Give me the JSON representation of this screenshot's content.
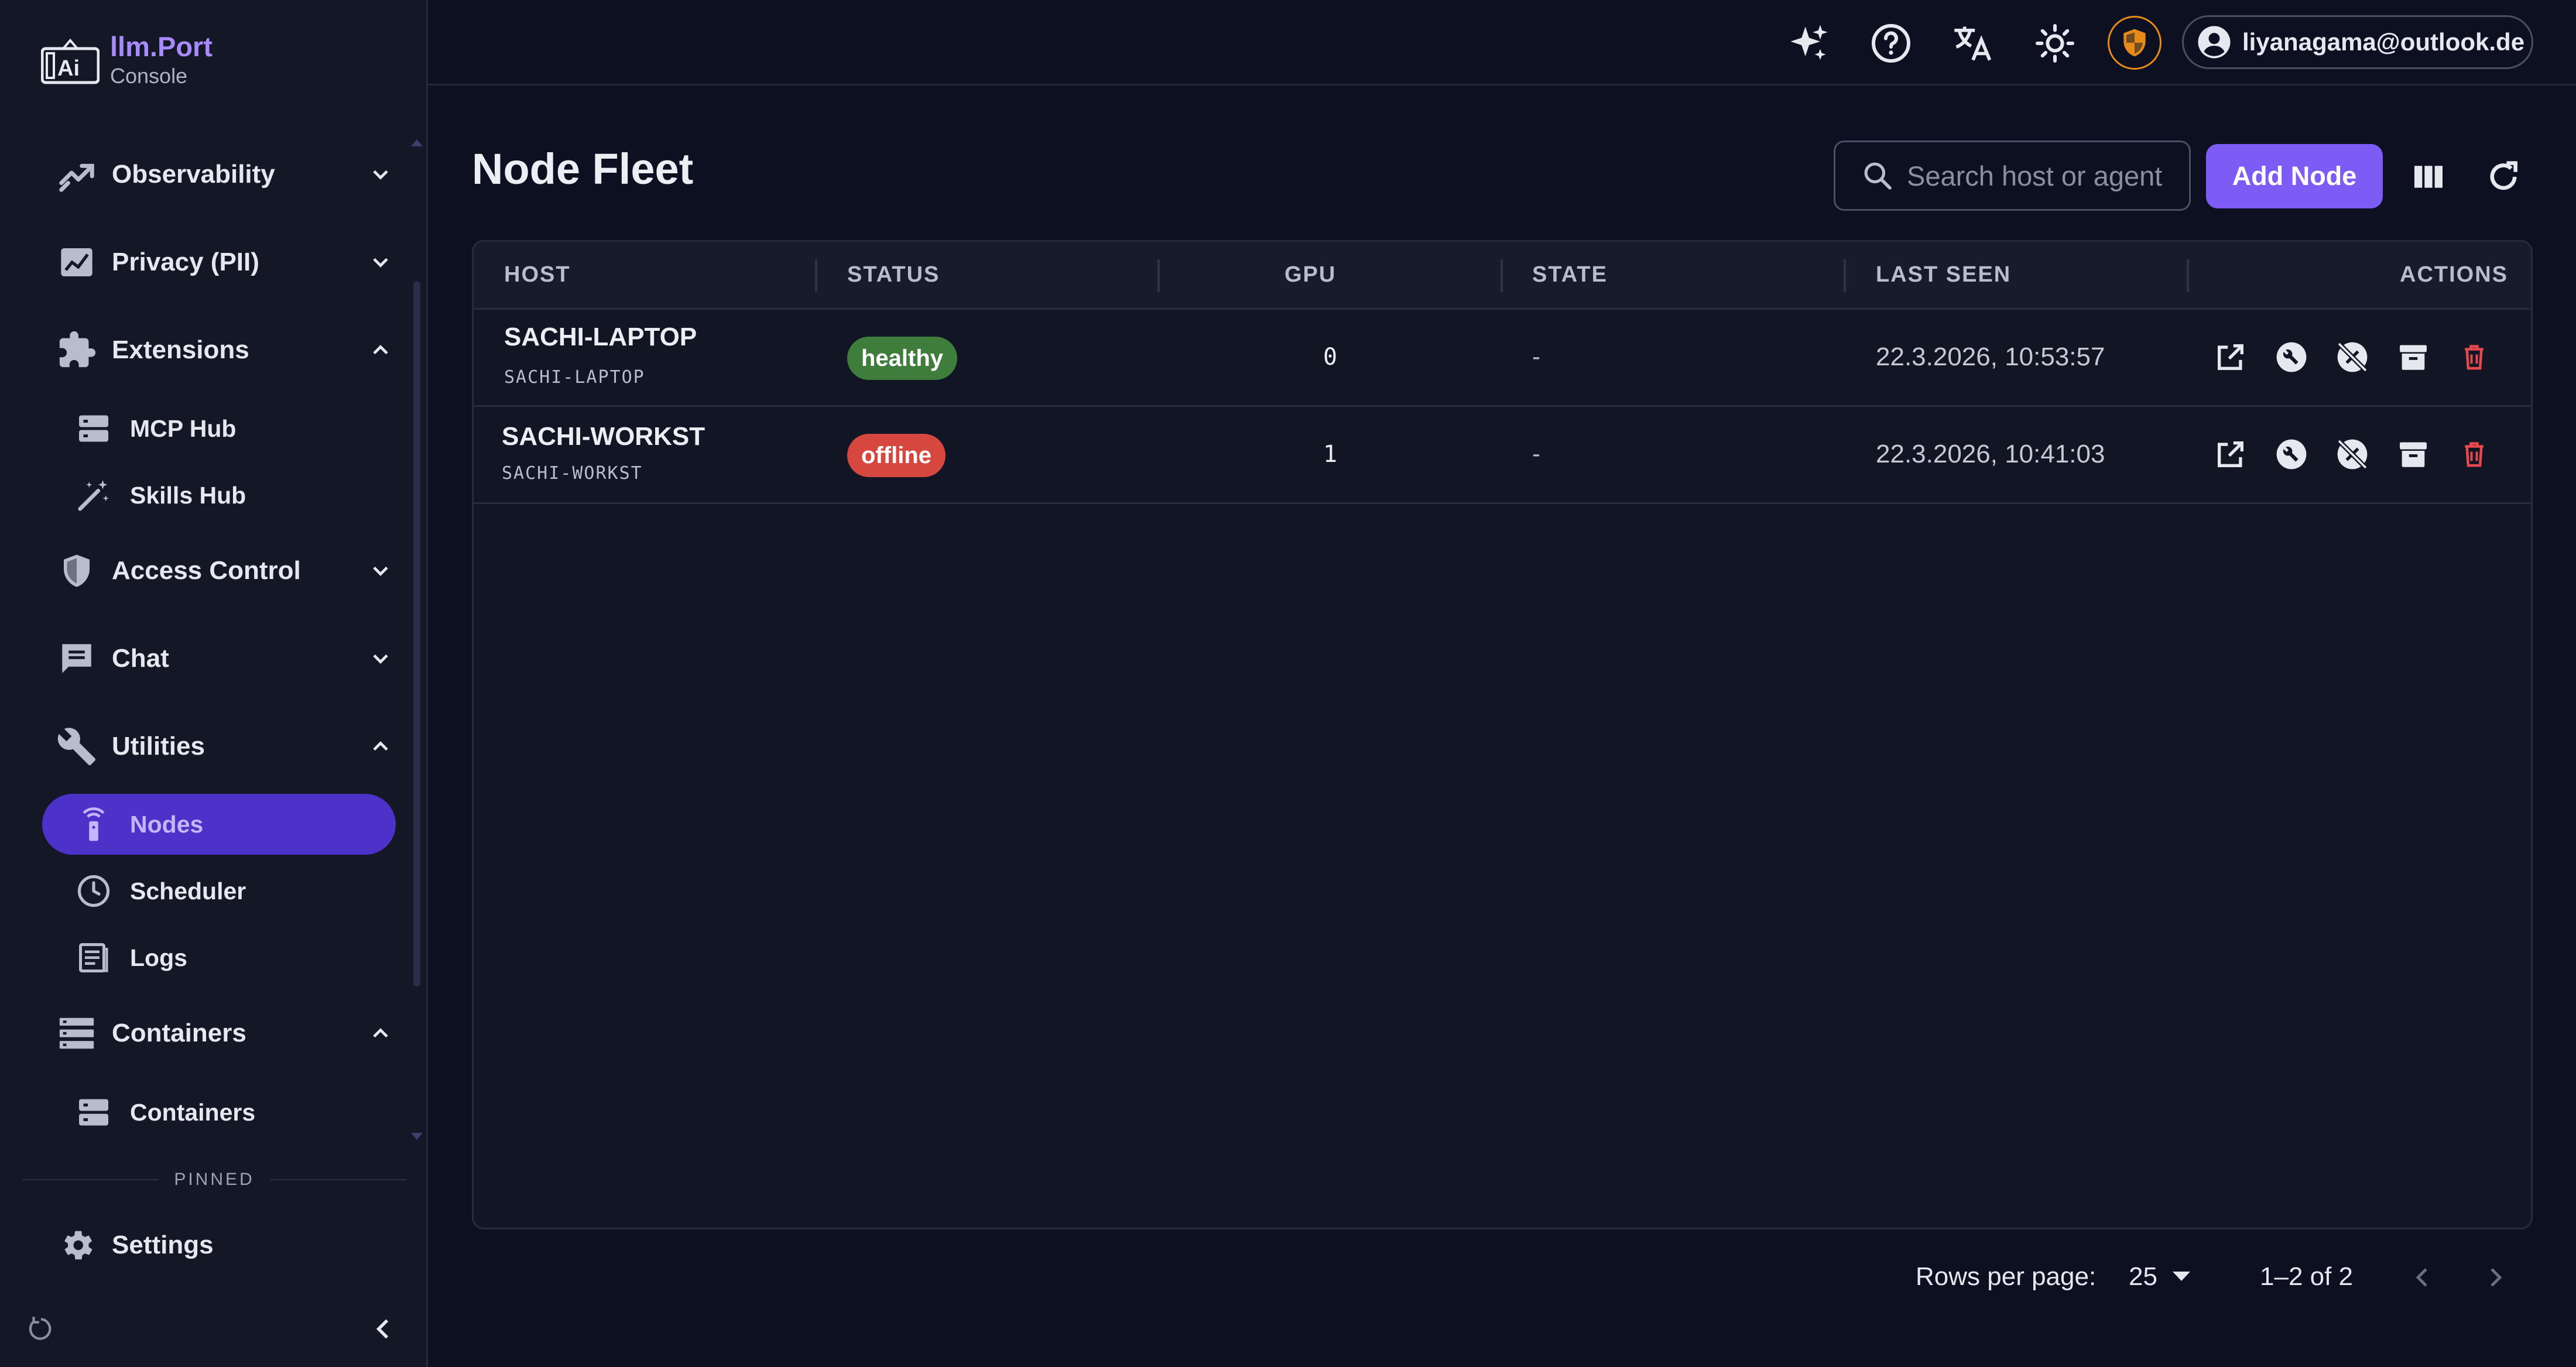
{
  "brand": {
    "name": "llm.Port",
    "sub": "Console"
  },
  "sidebar": {
    "groups": [
      {
        "label": "Observability",
        "icon": "observability-icon",
        "expanded": false
      },
      {
        "label": "Privacy (PII)",
        "icon": "privacy-icon",
        "expanded": false
      },
      {
        "label": "Extensions",
        "icon": "extensions-icon",
        "expanded": true,
        "items": [
          {
            "label": "MCP Hub",
            "icon": "server-icon"
          },
          {
            "label": "Skills Hub",
            "icon": "magic-wand-icon"
          }
        ]
      },
      {
        "label": "Access Control",
        "icon": "shield-icon",
        "expanded": false
      },
      {
        "label": "Chat",
        "icon": "chat-icon",
        "expanded": false
      },
      {
        "label": "Utilities",
        "icon": "wrench-icon",
        "expanded": true,
        "items": [
          {
            "label": "Nodes",
            "icon": "node-icon",
            "active": true
          },
          {
            "label": "Scheduler",
            "icon": "clock-icon"
          },
          {
            "label": "Logs",
            "icon": "logs-icon"
          }
        ]
      },
      {
        "label": "Containers",
        "icon": "containers-icon",
        "expanded": true,
        "items": [
          {
            "label": "Containers",
            "icon": "server-icon"
          }
        ]
      }
    ],
    "pinned_label": "PINNED",
    "pinned": [
      {
        "label": "Settings",
        "icon": "gear-icon"
      }
    ]
  },
  "topbar": {
    "icons": [
      "sparkle-icon",
      "help-icon",
      "translate-icon",
      "theme-sun-icon",
      "security-shield-icon"
    ],
    "user_email": "liyanagama@outlook.de"
  },
  "page": {
    "title": "Node Fleet"
  },
  "search": {
    "placeholder": "Search host or agent"
  },
  "actions": {
    "add_label": "Add Node"
  },
  "table": {
    "headers": {
      "host": "HOST",
      "status": "STATUS",
      "gpu": "GPU",
      "state": "STATE",
      "last_seen": "LAST SEEN",
      "actions": "ACTIONS"
    },
    "rows": [
      {
        "host": "SACHI-LAPTOP",
        "host_sub": "SACHI-LAPTOP",
        "status": "healthy",
        "gpu": "0",
        "state": "-",
        "last_seen": "22.3.2026, 10:53:57"
      },
      {
        "host": "SACHI-WORKST",
        "host_sub": "SACHI-WORKST",
        "status": "offline",
        "gpu": "1",
        "state": "-",
        "last_seen": "22.3.2026, 10:41:03"
      }
    ]
  },
  "pagination": {
    "rows_per_page_label": "Rows per page:",
    "rows_per_page": "25",
    "range": "1–2 of 2"
  },
  "colors": {
    "accent": "#7c5cf5",
    "active_nav": "#4c32c8",
    "healthy": "#3f7d3c",
    "offline": "#d5473f",
    "danger": "#e5484d",
    "security": "#e88a1a"
  }
}
